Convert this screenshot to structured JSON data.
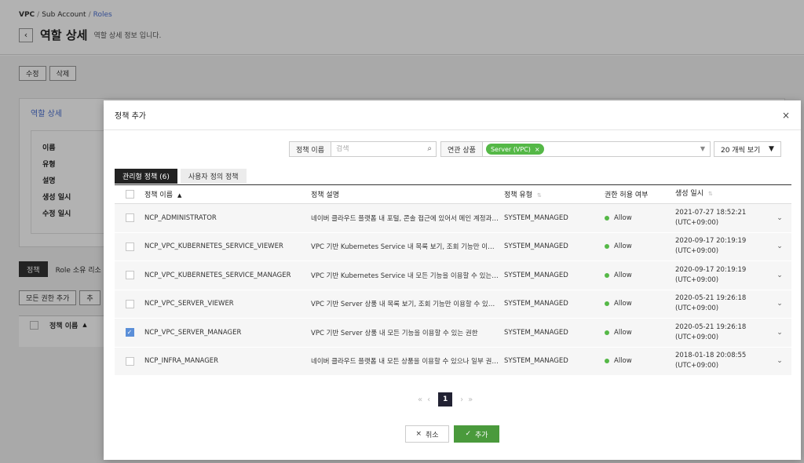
{
  "breadcrumb": {
    "root": "VPC",
    "sep": "/",
    "mid": "Sub Account",
    "current": "Roles"
  },
  "header": {
    "back_icon": "‹",
    "title": "역할 상세",
    "subtitle": "역할 상세 정보 입니다."
  },
  "page_buttons": {
    "edit": "수정",
    "delete": "삭제"
  },
  "detail": {
    "title": "역할 상세",
    "labels": [
      "이름",
      "유형",
      "설명",
      "생성 일시",
      "수정 일시"
    ]
  },
  "bg_tabs": {
    "policy": "정책",
    "role_owner": "Role 소유 리소"
  },
  "bg_buttons": {
    "all_perms": "모든 권한 추가",
    "add_partial": "추"
  },
  "bg_table": {
    "name_col": "정책 이름",
    "sort_icon": "▲"
  },
  "modal": {
    "title": "정책 추가",
    "close_icon": "×",
    "filter": {
      "name_label": "정책 이름",
      "search_placeholder": "검색",
      "search_icon": "⌕",
      "product_label": "연관 상품",
      "tag": "Server (VPC)",
      "tag_remove": "×",
      "dropdown_icon": "▼",
      "per_page": "20 개씩 보기",
      "per_page_icon": "▼"
    },
    "tabs": {
      "managed": "관리형 정책 (6)",
      "custom": "사용자 정의 정책"
    },
    "table": {
      "headers": {
        "name": "정책 이름",
        "description": "정책 설명",
        "type": "정책 유형",
        "allow": "권한 허용 여부",
        "created": "생성 일시"
      },
      "sort_up": "▲",
      "sort_both": "⇅",
      "expand_icon": "⌄",
      "check_icon": "✓",
      "rows": [
        {
          "name": "NCP_ADMINISTRATOR",
          "description": "네이버 클라우드 플랫폼 내 포털, 콘솔 접근에 있어서 메인 계정과 동일한 권한",
          "type": "SYSTEM_MANAGED",
          "allow": "Allow",
          "date": "2021-07-27 18:52:21",
          "tz": "(UTC+09:00)",
          "checked": false
        },
        {
          "name": "NCP_VPC_KUBERNETES_SERVICE_VIEWER",
          "description": "VPC 기반 Kubernetes Service 내 목록 보기, 조회 기능만 이용할 수 있는 권한",
          "type": "SYSTEM_MANAGED",
          "allow": "Allow",
          "date": "2020-09-17 20:19:19",
          "tz": "(UTC+09:00)",
          "checked": false
        },
        {
          "name": "NCP_VPC_KUBERNETES_SERVICE_MANAGER",
          "description": "VPC 기반 Kubernetes Service 내 모든 기능을 이용할 수 있는 권한",
          "type": "SYSTEM_MANAGED",
          "allow": "Allow",
          "date": "2020-09-17 20:19:19",
          "tz": "(UTC+09:00)",
          "checked": false
        },
        {
          "name": "NCP_VPC_SERVER_VIEWER",
          "description": "VPC 기반 Server 상품 내 목록 보기, 조회 기능만 이용할 수 있는 권한",
          "type": "SYSTEM_MANAGED",
          "allow": "Allow",
          "date": "2020-05-21 19:26:18",
          "tz": "(UTC+09:00)",
          "checked": false
        },
        {
          "name": "NCP_VPC_SERVER_MANAGER",
          "description": "VPC 기반 Server 상품 내 모든 기능을 이용할 수 있는 권한",
          "type": "SYSTEM_MANAGED",
          "allow": "Allow",
          "date": "2020-05-21 19:26:18",
          "tz": "(UTC+09:00)",
          "checked": true
        },
        {
          "name": "NCP_INFRA_MANAGER",
          "description": "네이버 클라우드 플랫폼 내 모든 상품을 이용할 수 있으나 일부 권한은 제한",
          "type": "SYSTEM_MANAGED",
          "allow": "Allow",
          "date": "2018-01-18 20:08:55",
          "tz": "(UTC+09:00)",
          "checked": false
        }
      ]
    },
    "pager": {
      "first": "«",
      "prev": "‹",
      "current": "1",
      "next": "›",
      "last": "»"
    },
    "footer": {
      "cancel_icon": "×",
      "cancel": "취소",
      "add_icon": "✓",
      "add": "추가"
    }
  },
  "colors": {
    "accent_blue": "#4a6fd1",
    "tag_green": "#55b847",
    "add_green": "#4a9a3c",
    "check_blue": "#5b8fd8"
  }
}
